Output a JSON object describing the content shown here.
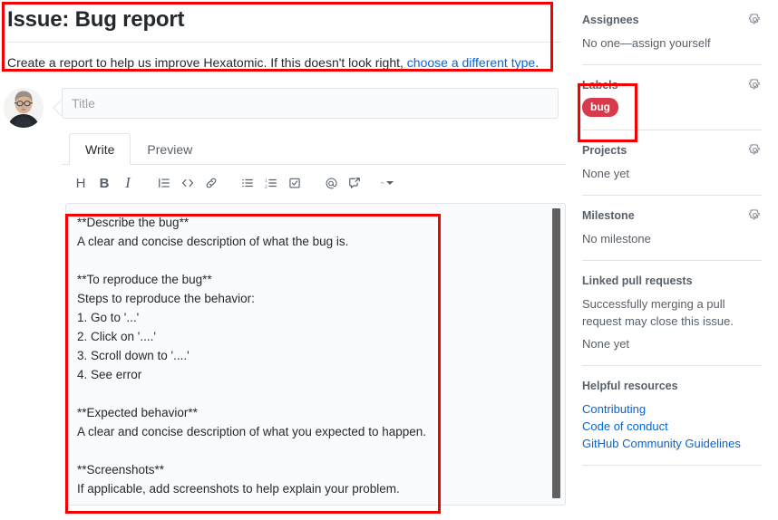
{
  "header": {
    "title": "Issue: Bug report",
    "subtitle_before": "Create a report to help us improve Hexatomic. If this doesn't look right, ",
    "subtitle_link": "choose a different type",
    "subtitle_after": "."
  },
  "form": {
    "title_placeholder": "Title",
    "title_value": "",
    "tabs": [
      {
        "label": "Write",
        "active": true
      },
      {
        "label": "Preview",
        "active": false
      }
    ],
    "toolbar": [
      {
        "name": "heading-icon",
        "glyph": "H"
      },
      {
        "name": "bold-icon",
        "glyph": "B"
      },
      {
        "name": "italic-icon",
        "glyph": "I"
      },
      {
        "name": "quote-icon",
        "glyph": "quote"
      },
      {
        "name": "code-icon",
        "glyph": "<>"
      },
      {
        "name": "link-icon",
        "glyph": "link"
      },
      {
        "name": "unordered-list-icon",
        "glyph": "ul"
      },
      {
        "name": "ordered-list-icon",
        "glyph": "ol"
      },
      {
        "name": "task-list-icon",
        "glyph": "task"
      },
      {
        "name": "mention-icon",
        "glyph": "@"
      },
      {
        "name": "cross-reference-icon",
        "glyph": "xref"
      },
      {
        "name": "saved-replies-icon",
        "glyph": "reply"
      }
    ],
    "body_value": "**Describe the bug**\nA clear and concise description of what the bug is.\n\n**To reproduce the bug**\nSteps to reproduce the behavior:\n1. Go to '...'\n2. Click on '....'\n3. Scroll down to '....'\n4. See error\n\n**Expected behavior**\nA clear and concise description of what you expected to happen.\n\n**Screenshots**\nIf applicable, add screenshots to help explain your problem."
  },
  "sidebar": {
    "assignees": {
      "heading": "Assignees",
      "value": "No one—assign yourself"
    },
    "labels": {
      "heading": "Labels",
      "badge": "bug",
      "badge_color": "#d73a4a"
    },
    "projects": {
      "heading": "Projects",
      "value": "None yet"
    },
    "milestone": {
      "heading": "Milestone",
      "value": "No milestone"
    },
    "linked_pull_requests": {
      "heading": "Linked pull requests",
      "note": "Successfully merging a pull request may close this issue.",
      "value": "None yet"
    },
    "helpful_resources": {
      "heading": "Helpful resources",
      "links": [
        "Contributing",
        "Code of conduct",
        "GitHub Community Guidelines"
      ]
    }
  },
  "annotations": {
    "accent_color": "#f40000",
    "boxes": [
      "header-block",
      "labels-section",
      "issue-body-textarea"
    ]
  }
}
